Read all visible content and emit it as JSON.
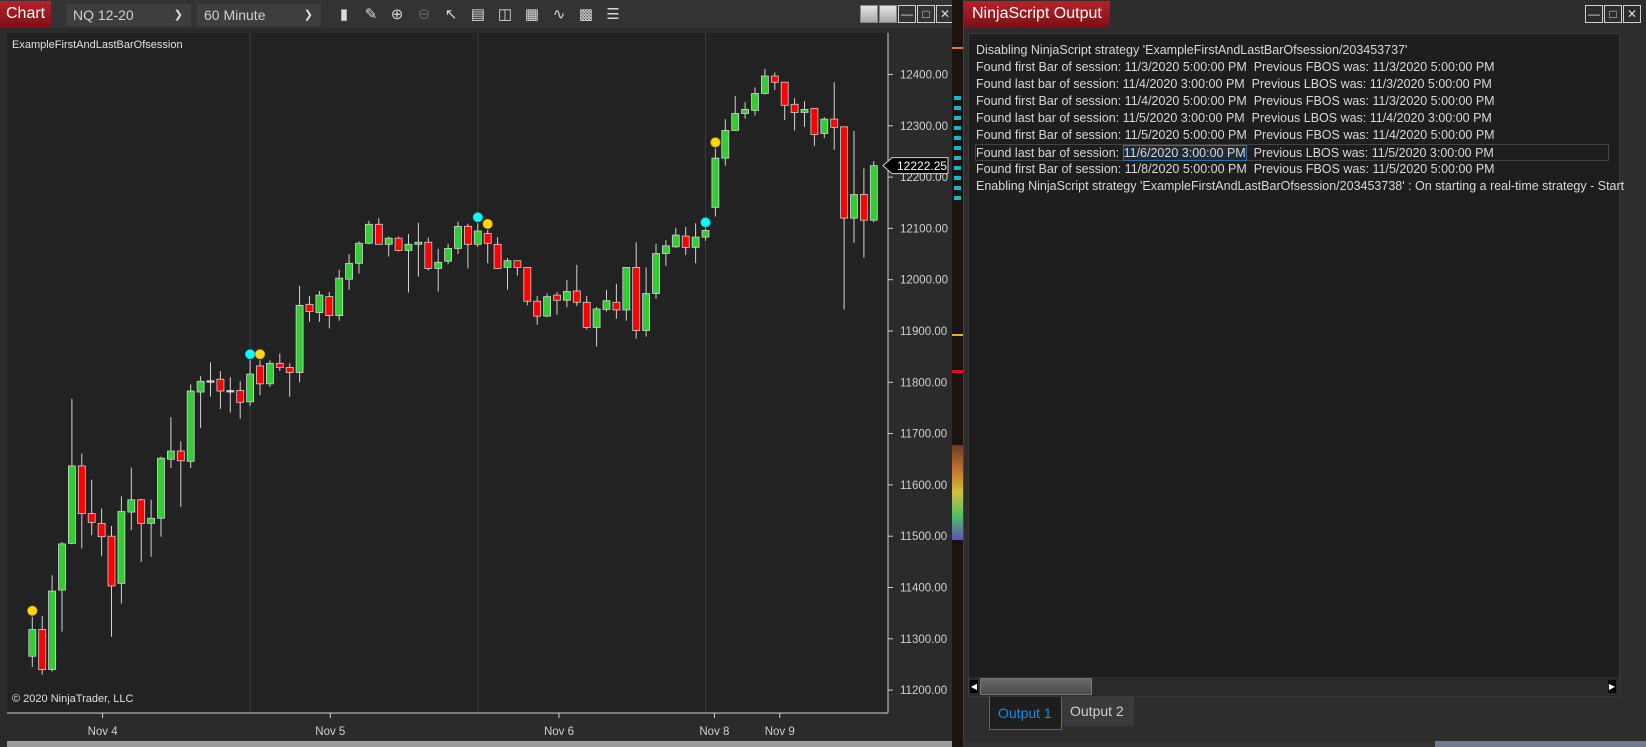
{
  "chart_window": {
    "title": "Chart",
    "instrument": "NQ 12-20",
    "interval": "60 Minute",
    "toolbar_icons": [
      "bar-type-icon",
      "drawing-tools-icon",
      "zoom-in-icon",
      "zoom-out-icon",
      "pointer-icon",
      "properties-icon",
      "data-box-icon",
      "chart-trader-icon",
      "strategies-icon",
      "indicators-icon",
      "list-icon"
    ],
    "strategy_label": "ExampleFirstAndLastBarOfsession",
    "copyright": "© 2020 NinjaTrader, LLC",
    "last_price_label": "12222.25"
  },
  "chart_data": {
    "type": "candlestick",
    "instrument": "NQ 12-20",
    "interval": "60 Minute",
    "ylim": [
      11200,
      12400
    ],
    "y_ticks": [
      "12400.00",
      "12300.00",
      "12200.00",
      "12100.00",
      "12000.00",
      "11900.00",
      "11800.00",
      "11700.00",
      "11600.00",
      "11500.00",
      "11400.00",
      "11300.00",
      "11200.00"
    ],
    "y_tick_values": [
      12400,
      12300,
      12200,
      12100,
      12000,
      11900,
      11800,
      11700,
      11600,
      11500,
      11400,
      11300,
      11200
    ],
    "x_labels": [
      {
        "label": "Nov 4",
        "bar": 7.1
      },
      {
        "label": "Nov 5",
        "bar": 30.1
      },
      {
        "label": "Nov 6",
        "bar": 53.2
      },
      {
        "label": "Nov 8",
        "bar": 68.9
      },
      {
        "label": "Nov 9",
        "bar": 75.5
      }
    ],
    "ohlc": [
      [
        11266,
        11343,
        11245,
        11318
      ],
      [
        11318,
        11344,
        11230,
        11240
      ],
      [
        11240,
        11424,
        11236,
        11393
      ],
      [
        11395,
        11489,
        11314,
        11485
      ],
      [
        11486,
        11768,
        11484,
        11637
      ],
      [
        11637,
        11661,
        11476,
        11544
      ],
      [
        11544,
        11610,
        11502,
        11527
      ],
      [
        11525,
        11554,
        11461,
        11499
      ],
      [
        11500,
        11520,
        11304,
        11403
      ],
      [
        11408,
        11578,
        11369,
        11548
      ],
      [
        11547,
        11634,
        11512,
        11571
      ],
      [
        11571,
        11573,
        11450,
        11525
      ],
      [
        11525,
        11571,
        11460,
        11535
      ],
      [
        11535,
        11655,
        11499,
        11652
      ],
      [
        11650,
        11732,
        11633,
        11666
      ],
      [
        11666,
        11685,
        11557,
        11647
      ],
      [
        11646,
        11796,
        11633,
        11783
      ],
      [
        11781,
        11812,
        11711,
        11802
      ],
      [
        11803,
        11839,
        11772,
        11803
      ],
      [
        11806,
        11822,
        11748,
        11783
      ],
      [
        11784,
        11810,
        11741,
        11784
      ],
      [
        11784,
        11802,
        11729,
        11761
      ],
      [
        11762,
        11843,
        11754,
        11816
      ],
      [
        11832,
        11843,
        11775,
        11797
      ],
      [
        11797,
        11843,
        11791,
        11837
      ],
      [
        11837,
        11856,
        11822,
        11829
      ],
      [
        11829,
        11837,
        11772,
        11819
      ],
      [
        11819,
        11988,
        11800,
        11950
      ],
      [
        11952,
        11968,
        11918,
        11938
      ],
      [
        11936,
        11978,
        11918,
        11970
      ],
      [
        11967,
        11976,
        11905,
        11930
      ],
      [
        11930,
        12019,
        11920,
        12003
      ],
      [
        12001,
        12050,
        11980,
        12032
      ],
      [
        12032,
        12075,
        12012,
        12071
      ],
      [
        12071,
        12115,
        12069,
        12108
      ],
      [
        12108,
        12120,
        12069,
        12069
      ],
      [
        12069,
        12084,
        12045,
        12081
      ],
      [
        12081,
        12084,
        12055,
        12057
      ],
      [
        12057,
        12089,
        11975,
        12069
      ],
      [
        12069,
        12111,
        12006,
        12073
      ],
      [
        12073,
        12082,
        12018,
        12022
      ],
      [
        12022,
        12060,
        11977,
        12034
      ],
      [
        12036,
        12070,
        12030,
        12061
      ],
      [
        12061,
        12113,
        12050,
        12104
      ],
      [
        12104,
        12109,
        12022,
        12069
      ],
      [
        12069,
        12110,
        12064,
        12095
      ],
      [
        12090,
        12097,
        12032,
        12071
      ],
      [
        12069,
        12083,
        12022,
        12022
      ],
      [
        12024,
        12042,
        11981,
        12037
      ],
      [
        12037,
        12037,
        12008,
        12024
      ],
      [
        12024,
        12024,
        11950,
        11958
      ],
      [
        11958,
        11968,
        11912,
        11929
      ],
      [
        11929,
        11973,
        11927,
        11967
      ],
      [
        11970,
        11976,
        11932,
        11960
      ],
      [
        11960,
        11999,
        11946,
        11977
      ],
      [
        11978,
        12029,
        11949,
        11956
      ],
      [
        11956,
        11968,
        11903,
        11907
      ],
      [
        11907,
        11947,
        11870,
        11943
      ],
      [
        11942,
        11980,
        11938,
        11959
      ],
      [
        11956,
        11992,
        11924,
        11941
      ],
      [
        11941,
        12024,
        11920,
        12024
      ],
      [
        12024,
        12073,
        11885,
        11901
      ],
      [
        11901,
        12024,
        11889,
        11973
      ],
      [
        11973,
        12070,
        11963,
        12051
      ],
      [
        12051,
        12077,
        12027,
        12066
      ],
      [
        12064,
        12101,
        12062,
        12087
      ],
      [
        12085,
        12103,
        12048,
        12063
      ],
      [
        12063,
        12110,
        12032,
        12083
      ],
      [
        12083,
        12100,
        12076,
        12096
      ],
      [
        12141,
        12256,
        12123,
        12237
      ],
      [
        12237,
        12313,
        12222,
        12291
      ],
      [
        12291,
        12358,
        12290,
        12324
      ],
      [
        12324,
        12346,
        12314,
        12332
      ],
      [
        12330,
        12375,
        12320,
        12363
      ],
      [
        12363,
        12411,
        12361,
        12397
      ],
      [
        12397,
        12404,
        12370,
        12385
      ],
      [
        12385,
        12385,
        12311,
        12340
      ],
      [
        12342,
        12354,
        12291,
        12326
      ],
      [
        12326,
        12348,
        12298,
        12332
      ],
      [
        12334,
        12334,
        12261,
        12283
      ],
      [
        12285,
        12317,
        12276,
        12313
      ],
      [
        12313,
        12385,
        12253,
        12297
      ],
      [
        12298,
        12298,
        11942,
        12120
      ],
      [
        12120,
        12290,
        12072,
        12166
      ],
      [
        12166,
        12217,
        12043,
        12116
      ],
      [
        12116,
        12231,
        12112,
        12222.25
      ]
    ],
    "first_bar_markers": [
      0,
      23,
      46,
      69
    ],
    "last_bar_markers": [
      22,
      45,
      68
    ],
    "session_break_bars": [
      22,
      45,
      68
    ],
    "last_price": 12222.25,
    "colors": {
      "up": "#32cd32",
      "down": "#ff0000",
      "outline": "#d3d3d3",
      "first_bar_marker": "#ffd700",
      "last_bar_marker": "#00ffff",
      "background": "#222222"
    }
  },
  "output_window": {
    "title": "NinjaScript Output",
    "lines": [
      "Disabling NinjaScript strategy 'ExampleFirstAndLastBarOfsession/203453737'",
      "Found first Bar of session: 11/3/2020 5:00:00 PM  Previous FBOS was: 11/3/2020 5:00:00 PM",
      "Found last bar of session: 11/4/2020 3:00:00 PM  Previous LBOS was: 11/3/2020 5:00:00 PM",
      "Found first Bar of session: 11/4/2020 5:00:00 PM  Previous FBOS was: 11/3/2020 5:00:00 PM",
      "Found last bar of session: 11/5/2020 3:00:00 PM  Previous LBOS was: 11/4/2020 3:00:00 PM",
      "Found first Bar of session: 11/5/2020 5:00:00 PM  Previous FBOS was: 11/4/2020 5:00:00 PM",
      "Found first Bar of session: 11/8/2020 5:00:00 PM  Previous FBOS was: 11/5/2020 5:00:00 PM",
      "Enabling NinjaScript strategy 'ExampleFirstAndLastBarOfsession/203453738' : On starting a real-time strategy - Start"
    ],
    "selected_line": {
      "prefix": "Found last bar of session: ",
      "selection": "11/6/2020 3:00:00 PM",
      "suffix": "  Previous LBOS was: 11/5/2020 3:00:00 PM"
    },
    "tabs": [
      {
        "label": "Output 1",
        "active": true
      },
      {
        "label": "Output 2",
        "active": false
      }
    ]
  }
}
